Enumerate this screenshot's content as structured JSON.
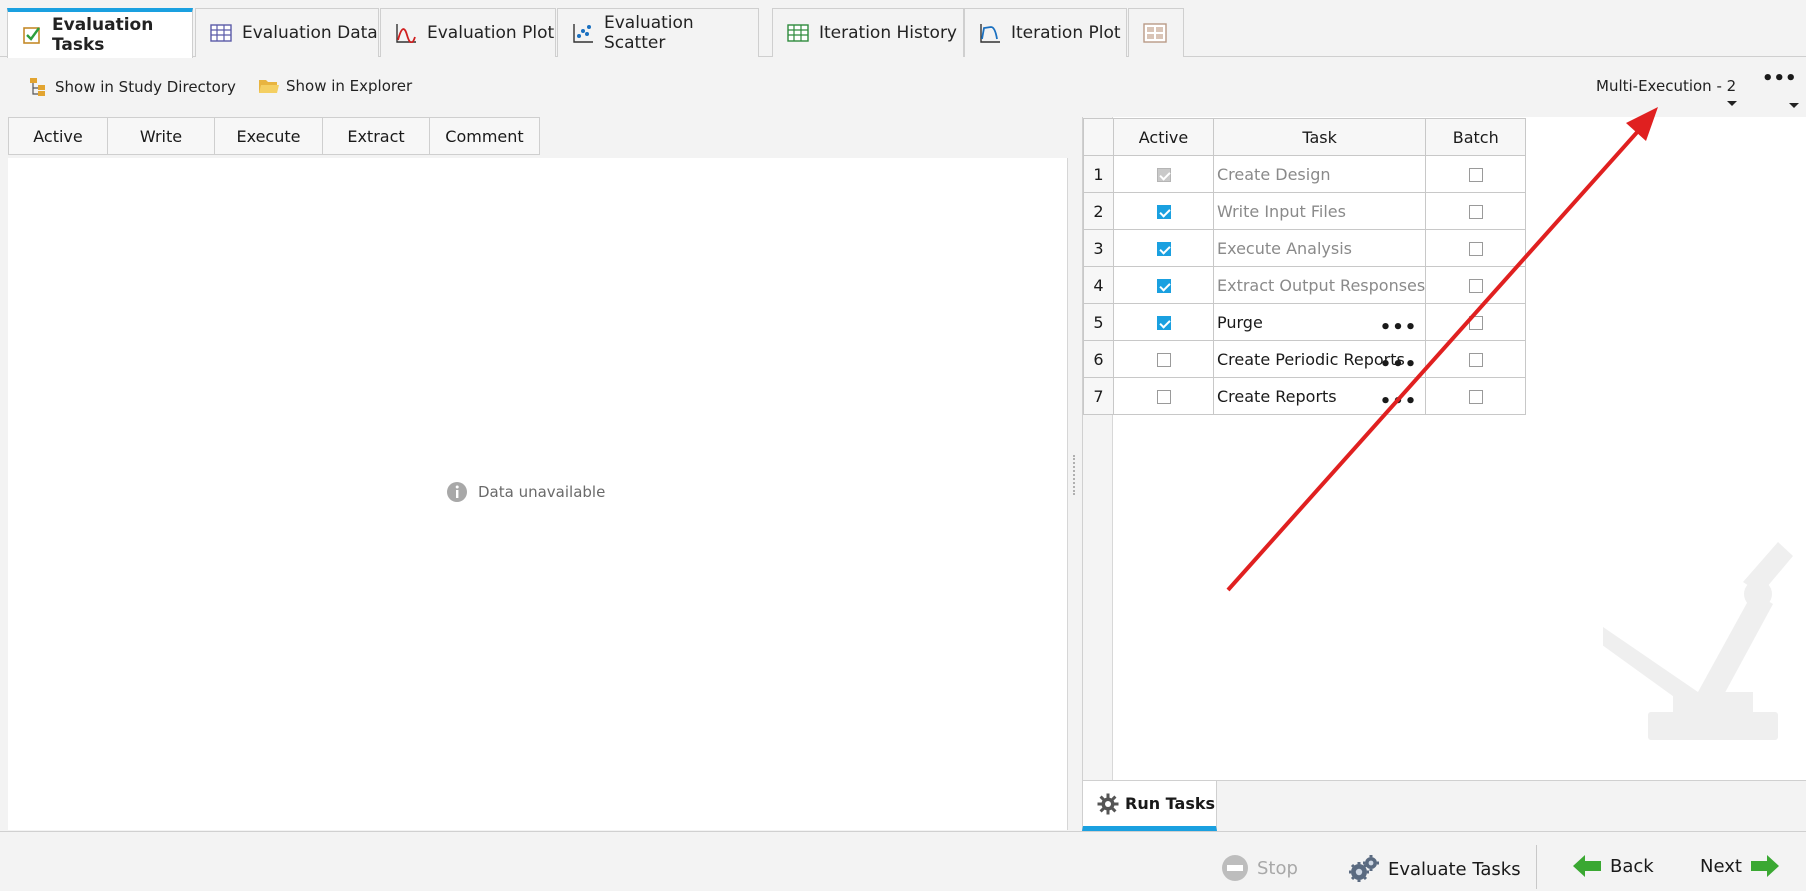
{
  "tabs": [
    {
      "label": "Evaluation Tasks",
      "active": true,
      "icon": "evaluation-tasks-icon"
    },
    {
      "label": "Evaluation Data",
      "active": false,
      "icon": "table-icon"
    },
    {
      "label": "Evaluation Plot",
      "active": false,
      "icon": "line-plot-icon"
    },
    {
      "label": "Evaluation Scatter",
      "active": false,
      "icon": "scatter-icon"
    },
    {
      "label": "Iteration History",
      "active": false,
      "icon": "grid-table-icon"
    },
    {
      "label": "Iteration Plot",
      "active": false,
      "icon": "iteration-plot-icon"
    }
  ],
  "toolbar": {
    "show_in_study_directory": "Show in Study Directory",
    "show_in_explorer": "Show in Explorer",
    "execution_selector": "Multi-Execution - 2",
    "more": "•••"
  },
  "left_grid": {
    "columns": [
      "Active",
      "Write",
      "Execute",
      "Extract",
      "Comment"
    ],
    "empty_message": "Data unavailable"
  },
  "task_table": {
    "columns": [
      "Active",
      "Task",
      "Batch"
    ],
    "rows": [
      {
        "num": "1",
        "active": "disabled",
        "task": "Create Design",
        "greyed": true,
        "dots": false,
        "batch": false
      },
      {
        "num": "2",
        "active": "checked",
        "task": "Write Input Files",
        "greyed": true,
        "dots": false,
        "batch": false
      },
      {
        "num": "3",
        "active": "checked",
        "task": "Execute Analysis",
        "greyed": true,
        "dots": false,
        "batch": false
      },
      {
        "num": "4",
        "active": "checked",
        "task": "Extract Output Responses",
        "greyed": true,
        "dots": false,
        "batch": false
      },
      {
        "num": "5",
        "active": "checked",
        "task": "Purge",
        "greyed": false,
        "dots": true,
        "batch": false
      },
      {
        "num": "6",
        "active": "unchecked",
        "task": "Create Periodic Reports",
        "greyed": false,
        "dots": true,
        "batch": false
      },
      {
        "num": "7",
        "active": "unchecked",
        "task": "Create Reports",
        "greyed": false,
        "dots": true,
        "batch": false
      }
    ],
    "dots_label": "•••"
  },
  "run_tab": {
    "label": "Run Tasks"
  },
  "footer": {
    "stop": "Stop",
    "evaluate": "Evaluate Tasks",
    "back": "Back",
    "next": "Next"
  },
  "colors": {
    "accent": "#1aa0e0",
    "annotation_arrow": "#e02020",
    "nav_green": "#3aa832"
  }
}
